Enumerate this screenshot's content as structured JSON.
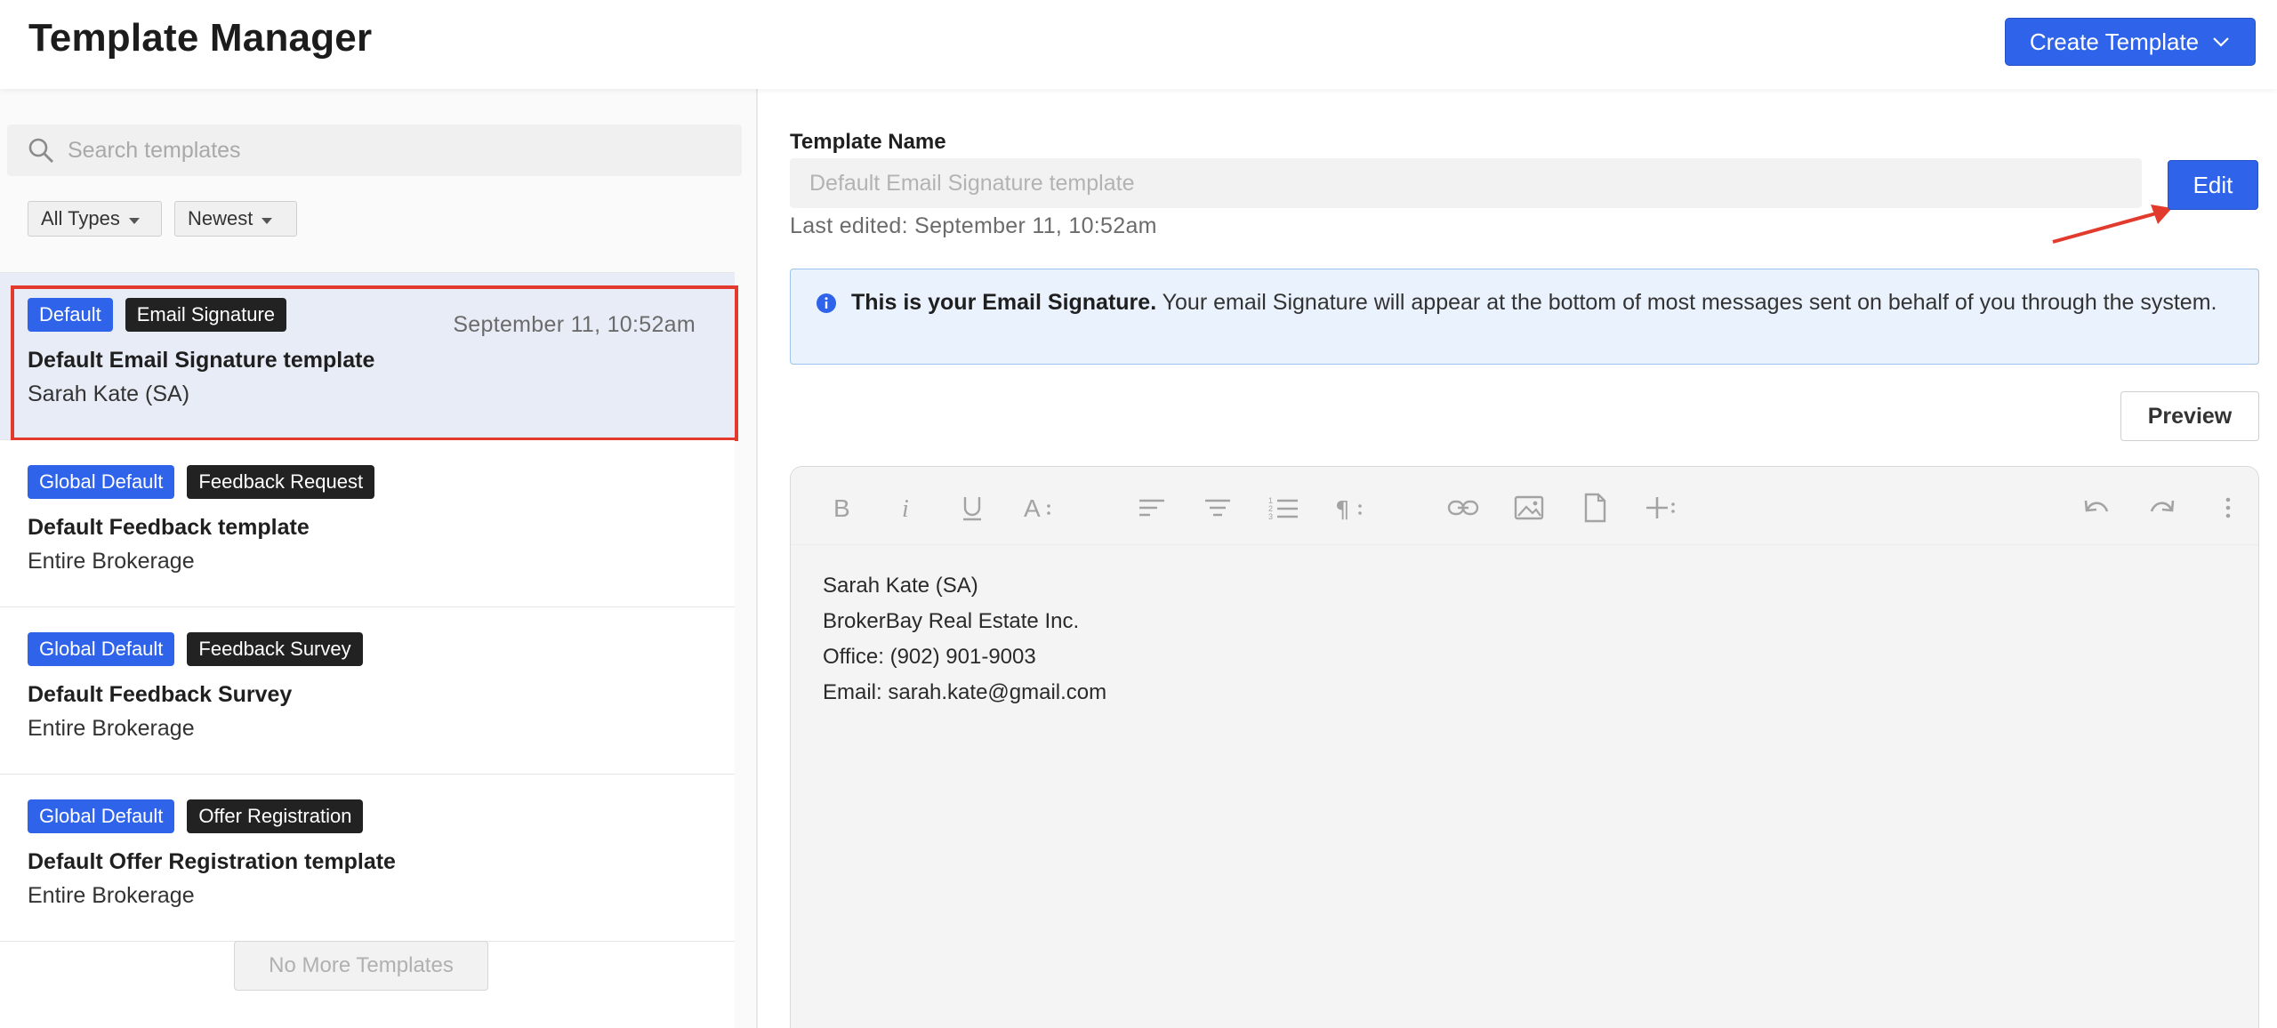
{
  "app": {
    "title": "Template Manager"
  },
  "header": {
    "create_button_label": "Create Template"
  },
  "search": {
    "placeholder": "Search templates"
  },
  "filters": {
    "type_label": "All Types",
    "sort_label": "Newest"
  },
  "templates": [
    {
      "badges": [
        "Default",
        "Email Signature"
      ],
      "title": "Default Email Signature template",
      "owner": "Sarah Kate (SA)",
      "date": "September 11, 10:52am",
      "selected": true
    },
    {
      "badges": [
        "Global Default",
        "Feedback Request"
      ],
      "title": "Default Feedback template",
      "owner": "Entire Brokerage"
    },
    {
      "badges": [
        "Global Default",
        "Feedback Survey"
      ],
      "title": "Default Feedback Survey",
      "owner": "Entire Brokerage"
    },
    {
      "badges": [
        "Global Default",
        "Offer Registration"
      ],
      "title": "Default Offer Registration template",
      "owner": "Entire Brokerage"
    }
  ],
  "list_footer": {
    "no_more_label": "No More Templates"
  },
  "detail": {
    "name_label": "Template Name",
    "name_placeholder": "Default Email Signature template",
    "last_edited": "Last edited: September 11, 10:52am",
    "edit_label": "Edit",
    "info_bold": "This is your Email Signature.",
    "info_text": " Your email Signature will appear at the bottom of most messages sent on behalf of you through the system.",
    "preview_label": "Preview"
  },
  "editor": {
    "toolbar_icons": [
      "bold-icon",
      "italic-icon",
      "underline-icon",
      "font-size-icon",
      "align-left-icon",
      "align-center-icon",
      "ordered-list-icon",
      "paragraph-icon",
      "link-icon",
      "image-icon",
      "file-icon",
      "insert-icon",
      "undo-icon",
      "redo-icon",
      "more-icon"
    ],
    "content_lines": [
      "Sarah Kate (SA)",
      "BrokerBay Real Estate Inc.",
      "Office: (902) 901-9003",
      "Email: sarah.kate@gmail.com"
    ]
  },
  "colors": {
    "accent": "#2f63ea",
    "badge_dark": "#222222",
    "highlight_border": "#e23b2e",
    "info_bg": "#eaf2fd"
  }
}
